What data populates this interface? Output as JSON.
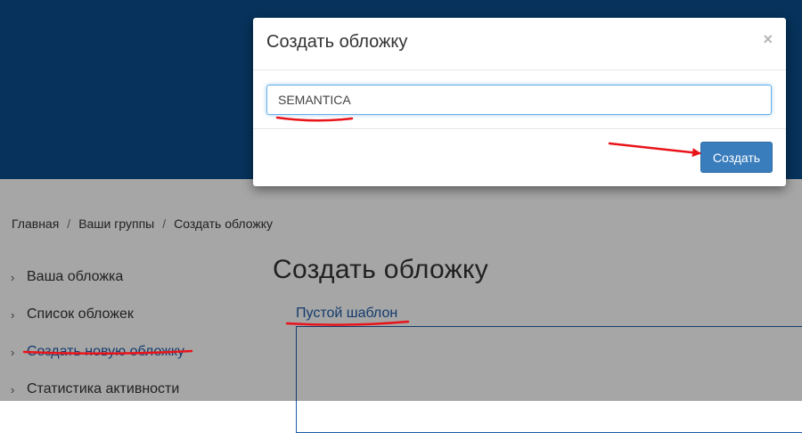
{
  "breadcrumb": {
    "items": [
      "Главная",
      "Ваши группы",
      "Создать обложку"
    ],
    "separator": "/"
  },
  "sidebar": {
    "items": [
      {
        "label": "Ваша обложка"
      },
      {
        "label": "Список обложек"
      },
      {
        "label": "Создать новую обложку",
        "active": true
      },
      {
        "label": "Статистика активности"
      }
    ]
  },
  "main": {
    "title": "Создать обложку",
    "template_link": "Пустой шаблон"
  },
  "modal": {
    "title": "Создать обложку",
    "close_label": "×",
    "input_value": "SEMANTICA",
    "create_label": "Создать"
  },
  "colors": {
    "header": "#0a4d8c",
    "link": "#1f5ba8",
    "primary_button": "#3a7dbd",
    "annotation_red": "#e8141a"
  }
}
